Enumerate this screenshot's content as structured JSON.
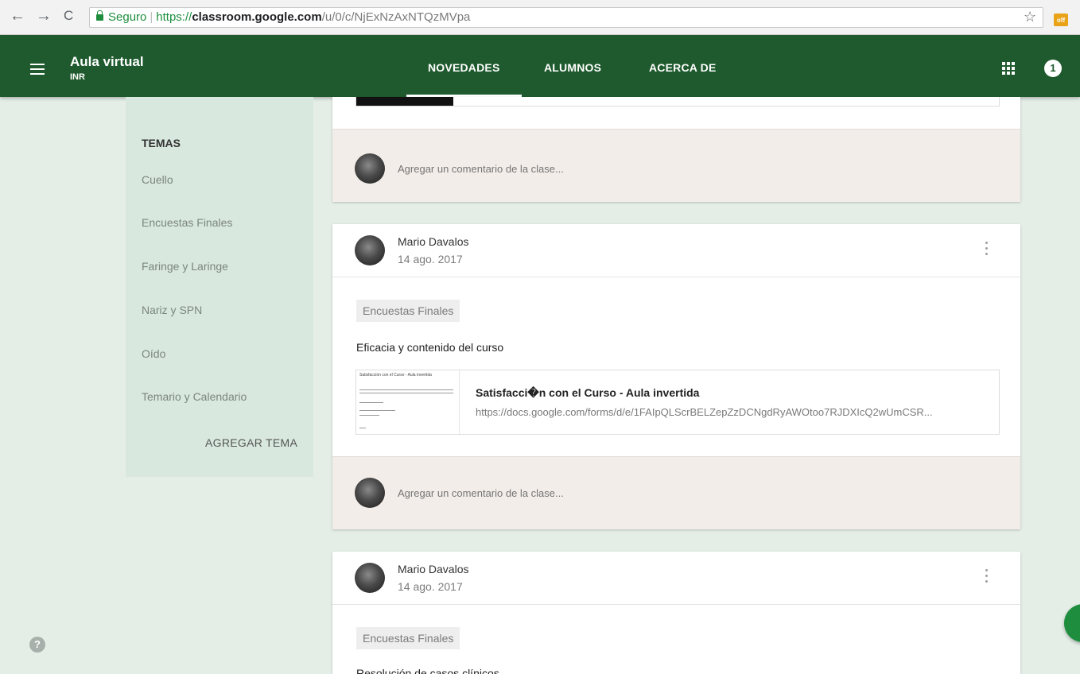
{
  "browser": {
    "secure_label": "Seguro",
    "url_scheme": "https://",
    "url_host": "classroom.google.com",
    "url_path": "/u/0/c/NjExNzAxNTQzMVpa",
    "back_icon": "←",
    "forward_icon": "→",
    "reload_icon": "C",
    "star_icon": "☆",
    "extension_label": "off"
  },
  "header": {
    "class_name": "Aula virtual",
    "class_section": "INR",
    "tabs": [
      {
        "label": "NOVEDADES",
        "active": true
      },
      {
        "label": "ALUMNOS",
        "active": false
      },
      {
        "label": "ACERCA DE",
        "active": false
      }
    ],
    "account_badge": "1",
    "accent_color": "#1e5a2d"
  },
  "sidebar": {
    "title": "TEMAS",
    "topics": [
      "Cuello",
      "Encuestas Finales",
      "Faringe y Laringe",
      "Nariz y SPN",
      "Oído",
      "Temario y Calendario"
    ],
    "add_topic_label": "AGREGAR TEMA",
    "help_icon": "?"
  },
  "stream": {
    "comment_placeholder": "Agregar un comentario de la clase...",
    "posts": [
      {
        "author": "Mario Davalos",
        "date": "14 ago. 2017",
        "topic_chip": "Encuestas Finales",
        "title": "Eficacia y contenido del curso",
        "attachment": {
          "thumb_title": "Satisfacción con el Curso - Aula invertida",
          "title": "Satisfacci�n con el Curso - Aula invertida",
          "url": "https://docs.google.com/forms/d/e/1FAIpQLScrBELZepZzDCNgdRyAWOtoo7RJDXIcQ2wUmCSR..."
        }
      },
      {
        "author": "Mario Davalos",
        "date": "14 ago. 2017",
        "topic_chip": "Encuestas Finales",
        "title": "Resolución de casos clínicos"
      }
    ]
  }
}
